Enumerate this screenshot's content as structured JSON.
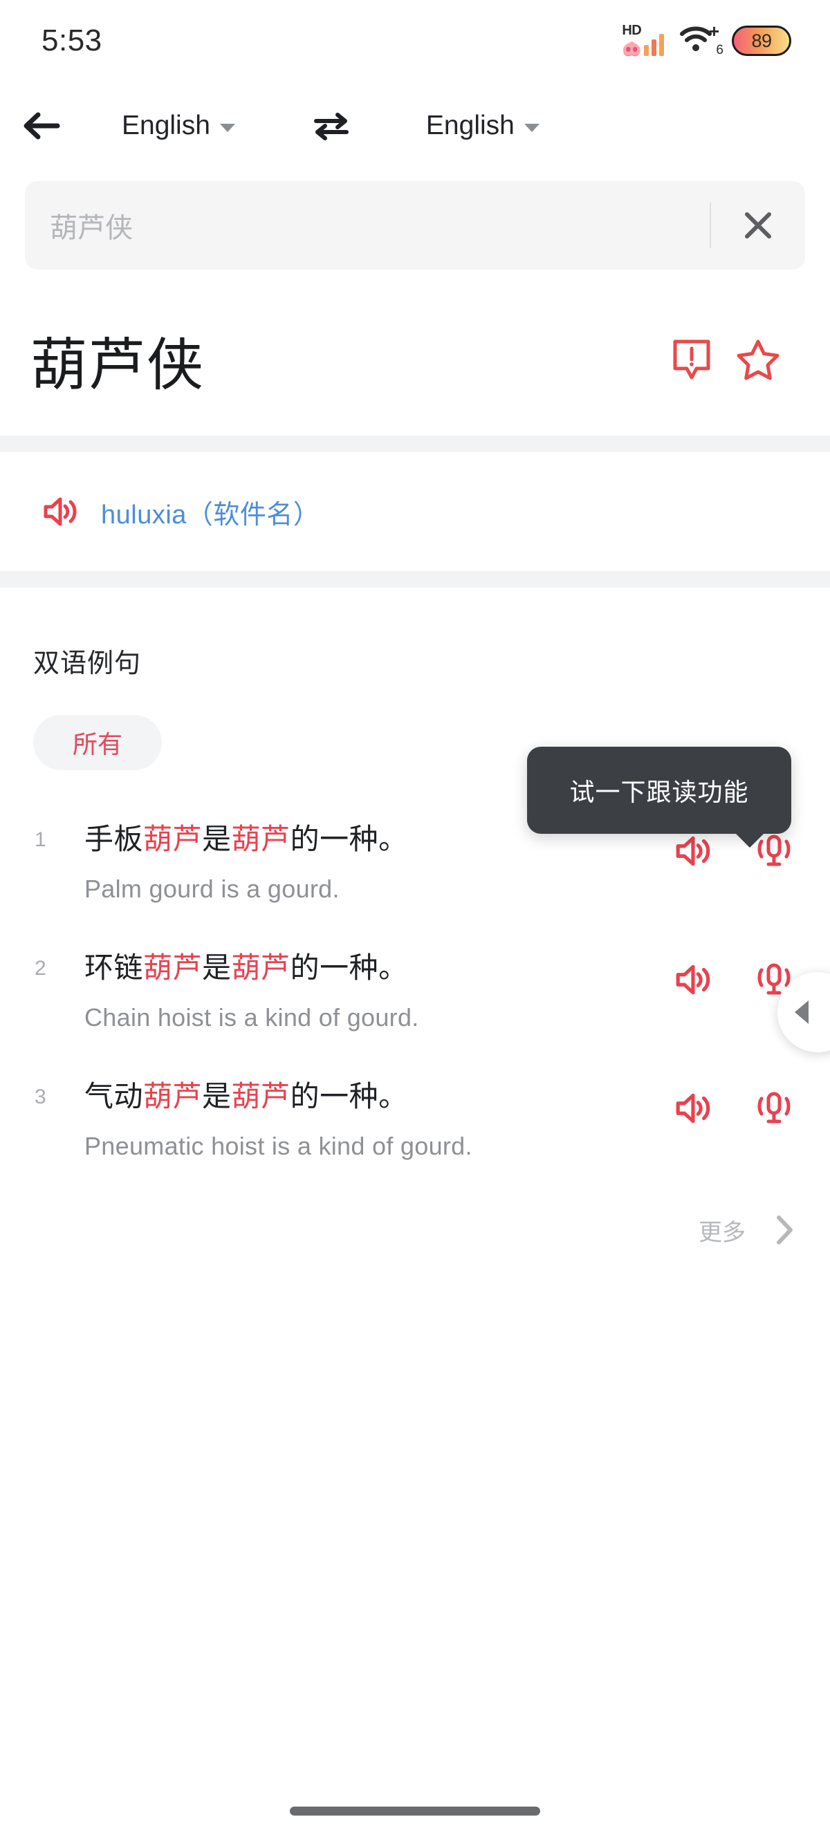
{
  "status_bar": {
    "time": "5:53",
    "hd_label": "HD",
    "wifi_plus": "+",
    "wifi_generation": "6",
    "battery_level": "89"
  },
  "app_bar": {
    "back_icon": "back-arrow-icon",
    "source_language": "English",
    "target_language": "English",
    "swap_icon": "swap-arrows-icon",
    "chevron_icon": "chevron-down-icon"
  },
  "search": {
    "value": "葫芦侠",
    "placeholder": "葫芦侠",
    "clear_icon": "close-icon"
  },
  "entry": {
    "headword": "葫芦侠",
    "report_icon": "report-icon",
    "favorite_icon": "star-icon",
    "pronounce_icon": "speaker-icon",
    "translation": "huluxia（软件名）"
  },
  "examples_section": {
    "title": "双语例句",
    "filter_chip": "所有",
    "more_label": "更多",
    "more_icon": "chevron-right-icon",
    "speaker_icon": "speaker-icon",
    "mic_icon": "microphone-icon",
    "items": [
      {
        "number": "1",
        "cn_pre": "手板",
        "cn_hl1": "葫芦",
        "cn_mid": "是",
        "cn_hl2": "葫芦",
        "cn_post": "的一种。",
        "en": "Palm gourd is a gourd."
      },
      {
        "number": "2",
        "cn_pre": "环链",
        "cn_hl1": "葫芦",
        "cn_mid": "是",
        "cn_hl2": "葫芦",
        "cn_post": "的一种。",
        "en": "Chain hoist is a kind of gourd."
      },
      {
        "number": "3",
        "cn_pre": "气动",
        "cn_hl1": "葫芦",
        "cn_mid": "是",
        "cn_hl2": "葫芦",
        "cn_post": "的一种。",
        "en": "Pneumatic hoist is a kind of gourd."
      }
    ]
  },
  "tooltip": {
    "text": "试一下跟读功能"
  },
  "floating_ball": {
    "icon": "triangle-left-icon"
  },
  "colors": {
    "accent_red": "#e8424f",
    "chip_red": "#e1495c",
    "link_blue": "#4c8ddc",
    "tooltip_bg": "#3c4045",
    "field_bg": "#f5f5f6",
    "band_gray": "#f2f3f4"
  }
}
